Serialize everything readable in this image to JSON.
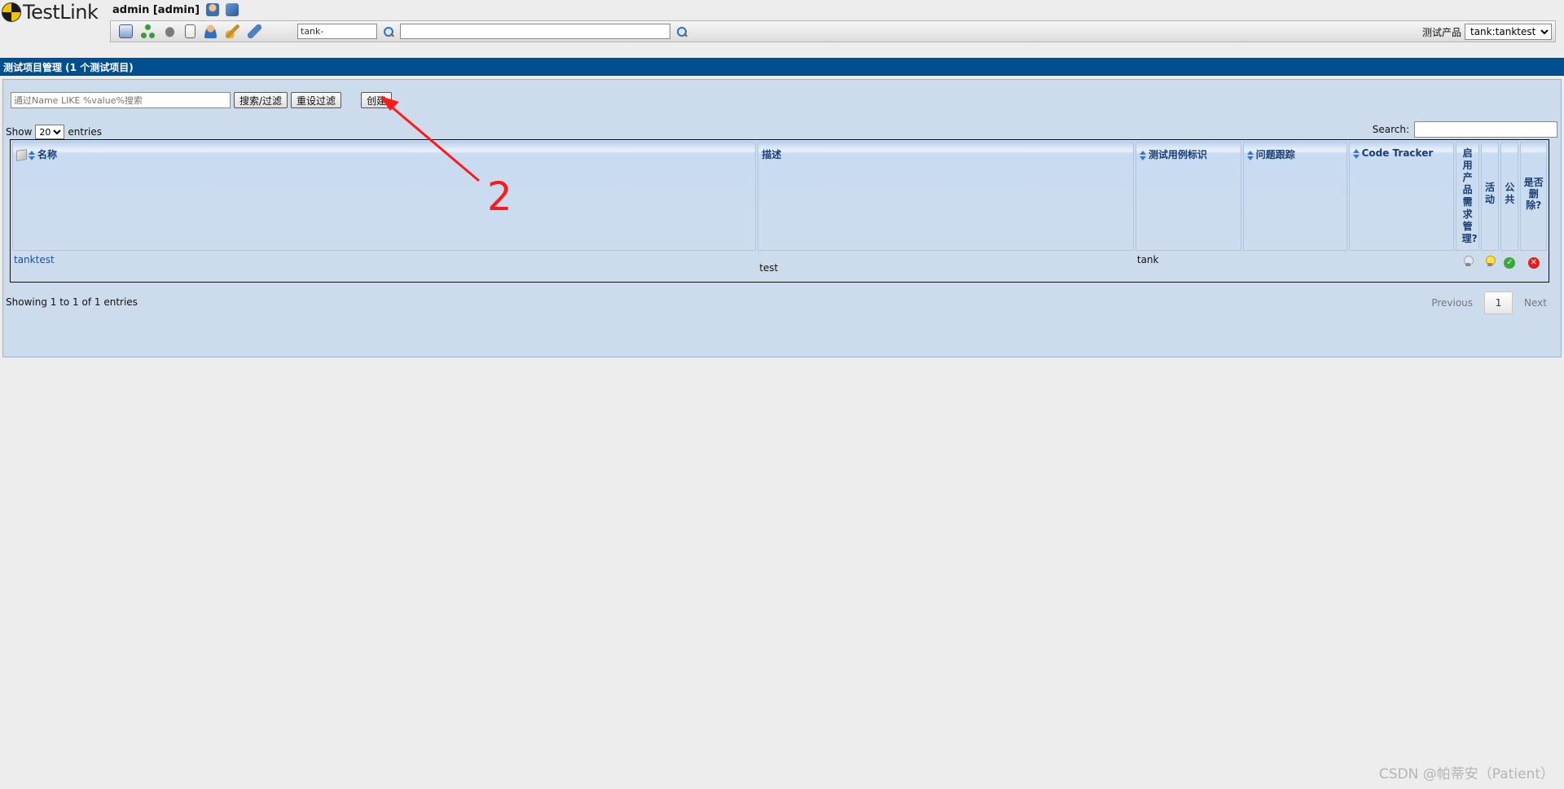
{
  "app": {
    "logo_text": "TestLink",
    "user_label": "admin [admin]"
  },
  "toolbar": {
    "icons": [
      "desktop-icon",
      "sitemap-icon",
      "bug-icon",
      "document-icon",
      "user-icon",
      "broom-icon",
      "feather-icon"
    ],
    "search_value": "tank-",
    "search2_value": "",
    "product_label": "测试产品",
    "product_selected": "tank:tanktest"
  },
  "section": {
    "title": "测试项目管理 (1 个测试项目)"
  },
  "filter": {
    "placeholder": "通过Name LIKE %value%搜索",
    "search_button": "搜索/过滤",
    "reset_button": "重设过滤",
    "create_button": "创建"
  },
  "table_controls": {
    "show_label": "Show",
    "show_value": "20",
    "entries_label": "entries",
    "search_label": "Search:"
  },
  "table": {
    "headers": {
      "name": "名称",
      "description": "描述",
      "testcase_prefix": "测试用例标识",
      "issue_tracker": "问题跟踪",
      "code_tracker": "Code Tracker",
      "req_mgmt": "启用产品需求管理?",
      "active": "活动",
      "public": "公共",
      "delete": "是否删除?"
    },
    "rows": [
      {
        "name": "tanktest",
        "description": "test",
        "prefix": "tank",
        "issue_tracker": "",
        "code_tracker": ""
      }
    ]
  },
  "pagination": {
    "info": "Showing 1 to 1 of 1 entries",
    "previous": "Previous",
    "current": "1",
    "next": "Next"
  },
  "annotation": {
    "number": "2",
    "color": "#ff1a1a"
  },
  "watermark": "CSDN @帕蒂安（Patient）",
  "colors": {
    "header_bar": "#004f91",
    "workarea": "#cddcec",
    "link": "#1a4f9c"
  }
}
